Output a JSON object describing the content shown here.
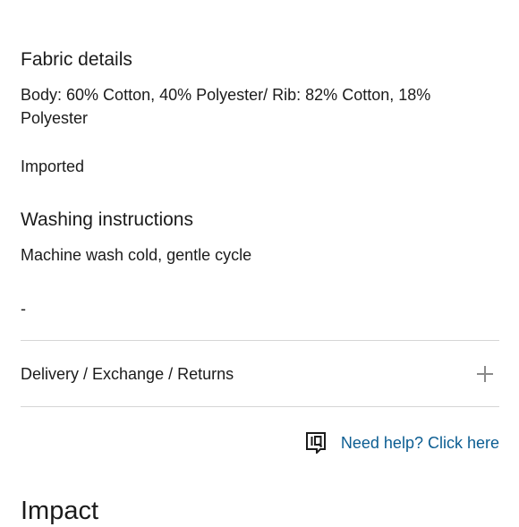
{
  "fabric": {
    "title": "Fabric details",
    "composition_line1": "Body: 60% Cotton, 40% Polyester/ Rib: 82% Cotton, 18%",
    "composition_line2": "Polyester",
    "origin": "Imported"
  },
  "washing": {
    "title": "Washing instructions",
    "instructions": "Machine wash cold, gentle cycle",
    "note": "-"
  },
  "accordion": {
    "label": "Delivery / Exchange / Returns",
    "icon": "plus-icon"
  },
  "help": {
    "icon": "iq-chat-icon",
    "link_text": "Need help? Click here",
    "link_color": "#0b5d92"
  },
  "impact": {
    "title": "Impact"
  }
}
